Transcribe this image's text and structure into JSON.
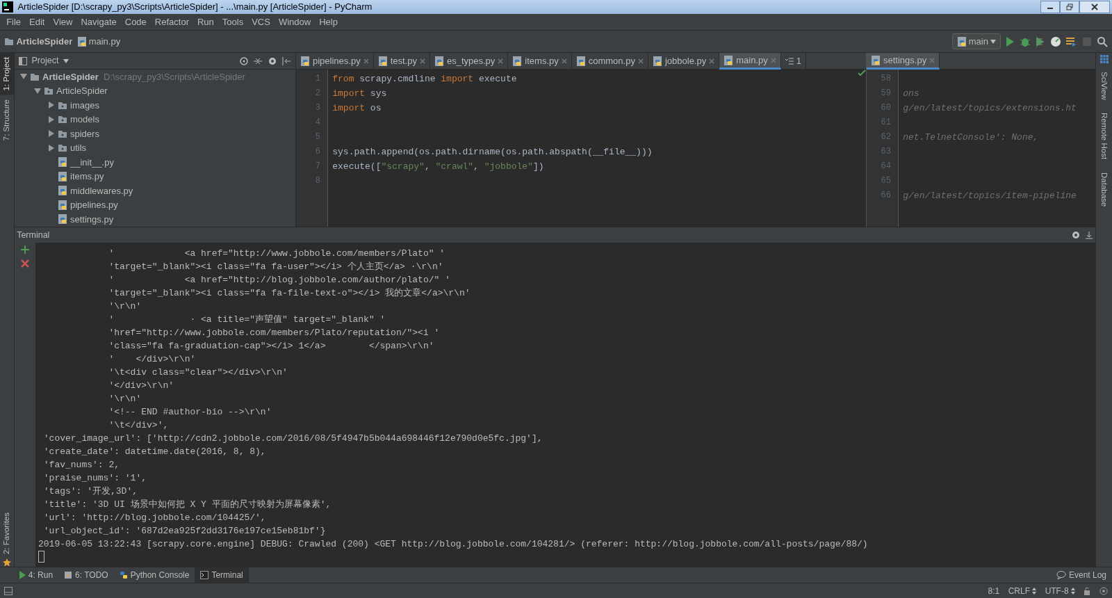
{
  "window": {
    "title": "ArticleSpider [D:\\scrapy_py3\\Scripts\\ArticleSpider] - ...\\main.py [ArticleSpider] - PyCharm"
  },
  "menu": [
    "File",
    "Edit",
    "View",
    "Navigate",
    "Code",
    "Refactor",
    "Run",
    "Tools",
    "VCS",
    "Window",
    "Help"
  ],
  "breadcrumbs": [
    {
      "kind": "folder",
      "label": "ArticleSpider"
    },
    {
      "kind": "file",
      "label": "main.py"
    }
  ],
  "run_config": {
    "label": "main"
  },
  "left_tools": [
    {
      "label": "1: Project",
      "selected": true
    },
    {
      "label": "7: Structure",
      "selected": false
    }
  ],
  "left_tools_bottom": [
    {
      "label": "2: Favorites",
      "selected": false
    }
  ],
  "project_panel": {
    "title": "Project",
    "tree": [
      {
        "kind": "folder",
        "label": "ArticleSpider",
        "hint": "D:\\scrapy_py3\\Scripts\\ArticleSpider",
        "expanded": true,
        "children": [
          {
            "kind": "package",
            "label": "ArticleSpider",
            "expanded": true,
            "children": [
              {
                "kind": "package",
                "label": "images",
                "expanded": false
              },
              {
                "kind": "package",
                "label": "models",
                "expanded": false
              },
              {
                "kind": "package",
                "label": "spiders",
                "expanded": false
              },
              {
                "kind": "package",
                "label": "utils",
                "expanded": false
              },
              {
                "kind": "file",
                "label": "__init__.py"
              },
              {
                "kind": "file",
                "label": "items.py"
              },
              {
                "kind": "file",
                "label": "middlewares.py"
              },
              {
                "kind": "file",
                "label": "pipelines.py"
              },
              {
                "kind": "file",
                "label": "settings.py"
              }
            ]
          }
        ]
      }
    ]
  },
  "editor_tabs": [
    {
      "label": "pipelines.py",
      "selected": false
    },
    {
      "label": "test.py",
      "selected": false
    },
    {
      "label": "es_types.py",
      "selected": false
    },
    {
      "label": "items.py",
      "selected": false
    },
    {
      "label": "common.py",
      "selected": false
    },
    {
      "label": "jobbole.py",
      "selected": false
    },
    {
      "label": "main.py",
      "selected": true
    }
  ],
  "tab_overflow_count": "1",
  "editor": {
    "lines": [
      {
        "number": "1",
        "tokens": [
          {
            "kind": "kw",
            "text": "from"
          },
          {
            "kind": "plain",
            "text": " scrapy.cmdline "
          },
          {
            "kind": "kw",
            "text": "import"
          },
          {
            "kind": "plain",
            "text": " execute"
          }
        ]
      },
      {
        "number": "2",
        "tokens": [
          {
            "kind": "kw",
            "text": "import"
          },
          {
            "kind": "plain",
            "text": " sys"
          }
        ]
      },
      {
        "number": "3",
        "tokens": [
          {
            "kind": "kw",
            "text": "import"
          },
          {
            "kind": "plain",
            "text": " os"
          }
        ]
      },
      {
        "number": "4"
      },
      {
        "number": "5"
      },
      {
        "number": "6",
        "tokens": [
          {
            "kind": "plain",
            "text": "sys.path.append(os.path.dirname(os.path.abspath(__file__)))"
          }
        ]
      },
      {
        "number": "7",
        "tokens": [
          {
            "kind": "plain",
            "text": "execute(["
          },
          {
            "kind": "str",
            "text": "\"scrapy\""
          },
          {
            "kind": "plain",
            "text": ", "
          },
          {
            "kind": "str",
            "text": "\"crawl\""
          },
          {
            "kind": "plain",
            "text": ", "
          },
          {
            "kind": "str",
            "text": "\"jobbole\""
          },
          {
            "kind": "plain",
            "text": "])"
          }
        ]
      },
      {
        "number": "8"
      }
    ]
  },
  "split_editor": {
    "tab": {
      "label": "settings.py",
      "selected": true
    },
    "lines": [
      {
        "number": "58"
      },
      {
        "number": "59",
        "text": "ons"
      },
      {
        "number": "60",
        "text": "g/en/latest/topics/extensions.ht"
      },
      {
        "number": "61"
      },
      {
        "number": "62",
        "text": "net.TelnetConsole': None,"
      },
      {
        "number": "63"
      },
      {
        "number": "64"
      },
      {
        "number": "65"
      },
      {
        "number": "66",
        "text": "g/en/latest/topics/item-pipeline"
      }
    ]
  },
  "right_tools": [
    "SciView",
    "Remote Host",
    "Database"
  ],
  "terminal": {
    "title": "Terminal",
    "lines": [
      "             '             <a href=\"http://www.jobbole.com/members/Plato\" '",
      "             'target=\"_blank\"><i class=\"fa fa-user\"></i> 个人主页</a> ·\\r\\n'",
      "             '             <a href=\"http://blog.jobbole.com/author/plato/\" '",
      "             'target=\"_blank\"><i class=\"fa fa-file-text-o\"></i> 我的文章</a>\\r\\n'",
      "             '\\r\\n'",
      "             '              · <a title=\"声望值\" target=\"_blank\" '",
      "             'href=\"http://www.jobbole.com/members/Plato/reputation/\"><i '",
      "             'class=\"fa fa-graduation-cap\"></i> 1</a>        </span>\\r\\n'",
      "             '    </div>\\r\\n'",
      "             '\\t<div class=\"clear\"></div>\\r\\n'",
      "             '</div>\\r\\n'",
      "             '\\r\\n'",
      "             '<!-- END #author-bio -->\\r\\n'",
      "             '\\t</div>',",
      " 'cover_image_url': ['http://cdn2.jobbole.com/2016/08/5f4947b5b044a698446f12e790d0e5fc.jpg'],",
      " 'create_date': datetime.date(2016, 8, 8),",
      " 'fav_nums': 2,",
      " 'praise_nums': '1',",
      " 'tags': '开发,3D',",
      " 'title': '3D UI 场景中如何把 X Y 平面的尺寸映射为屏幕像素',",
      " 'url': 'http://blog.jobbole.com/104425/',",
      " 'url_object_id': '687d2ea925f2dd3176e197ce15eb81bf'}",
      "2019-06-05 13:22:43 [scrapy.core.engine] DEBUG: Crawled (200) <GET http://blog.jobbole.com/104281/> (referer: http://blog.jobbole.com/all-posts/page/88/)"
    ]
  },
  "bottom_tabs": [
    {
      "kind": "run",
      "label": "4: Run",
      "selected": false
    },
    {
      "kind": "todo",
      "label": "6: TODO",
      "selected": false
    },
    {
      "kind": "console",
      "label": "Python Console",
      "selected": false
    },
    {
      "kind": "terminal",
      "label": "Terminal",
      "selected": true
    }
  ],
  "event_log": "Event Log",
  "status_bar": {
    "position": "8:1",
    "line_separator": "CRLF",
    "encoding": "UTF-8"
  }
}
